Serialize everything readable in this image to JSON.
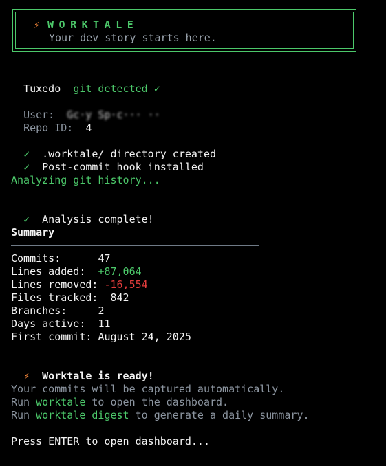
{
  "banner": {
    "bolt": "⚡",
    "title": "WORKTALE",
    "subtitle": "Your dev story starts here."
  },
  "detect": {
    "name": "Tuxedo",
    "status": "git detected ✓"
  },
  "info": {
    "user_label": "User:",
    "user_value": "Gc·y Sp·c··· ··",
    "repo_label": "Repo ID:",
    "repo_value": "4"
  },
  "setup": [
    {
      "check": "✓",
      "text": ".worktale/ directory created"
    },
    {
      "check": "✓",
      "text": "Post-commit hook installed"
    }
  ],
  "analyzing": "Analyzing git history...",
  "analysis_done": {
    "check": "✓",
    "text": "Analysis complete!"
  },
  "summary": {
    "heading": "Summary",
    "commits_label": "Commits:",
    "commits_value": "47",
    "added_label": "Lines added:",
    "added_value": "+87,064",
    "removed_label": "Lines removed:",
    "removed_value": "-16,554",
    "files_label": "Files tracked:",
    "files_value": "842",
    "branches_label": "Branches:",
    "branches_value": "2",
    "days_label": "Days active:",
    "days_value": "11",
    "first_label": "First commit:",
    "first_value": "August 24, 2025"
  },
  "ready": {
    "bolt": "⚡",
    "text": "Worktale is ready!"
  },
  "hints": {
    "line1": "Your commits will be captured automatically.",
    "run_prefix": "Run",
    "cmd1": "worktale",
    "line2_suffix": "to open the dashboard.",
    "cmd2": "worktale digest",
    "line3_suffix": "to generate a daily summary."
  },
  "prompt": "Press ENTER to open dashboard...",
  "colors": {
    "green": "#4cc86a",
    "red": "#e23c3c",
    "orange": "#f5863a",
    "gray": "#8c95a0",
    "background": "#000000"
  }
}
